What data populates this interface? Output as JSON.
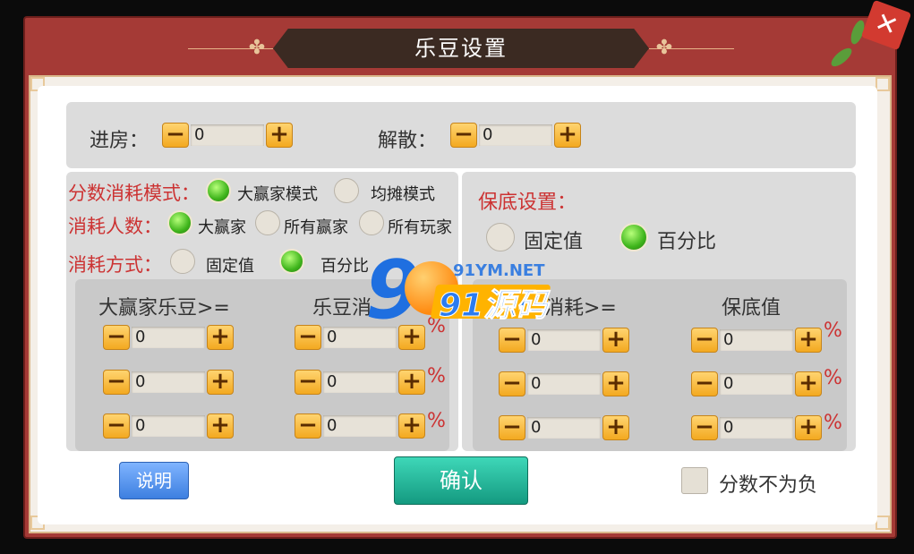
{
  "title": "乐豆设置",
  "close_label": "✕",
  "top_row": {
    "enter_label": "进房：",
    "enter_value": "0",
    "dissolve_label": "解散：",
    "dissolve_value": "0"
  },
  "minus": "−",
  "plus": "+",
  "score_mode": {
    "label": "分数消耗模式：",
    "options": [
      "大赢家模式",
      "均摊模式"
    ],
    "selected": "大赢家模式"
  },
  "consume_people": {
    "label": "消耗人数：",
    "options": [
      "大赢家",
      "所有赢家",
      "所有玩家"
    ],
    "selected": "大赢家"
  },
  "consume_method": {
    "label": "消耗方式：",
    "options": [
      "固定值",
      "百分比"
    ],
    "selected": "百分比"
  },
  "guarantee": {
    "label": "保底设置：",
    "options": [
      "固定值",
      "百分比"
    ],
    "selected": "百分比"
  },
  "left_table": {
    "headers": [
      "大赢家乐豆>=",
      "乐豆消"
    ],
    "rows": [
      [
        "0",
        "0"
      ],
      [
        "0",
        "0"
      ],
      [
        "0",
        "0"
      ]
    ]
  },
  "right_table": {
    "headers": [
      "消耗>=",
      "保底值"
    ],
    "rows": [
      [
        "0",
        "0"
      ],
      [
        "0",
        "0"
      ],
      [
        "0",
        "0"
      ]
    ]
  },
  "percent": "%",
  "buttons": {
    "help": "说明",
    "confirm": "确认"
  },
  "no_negative_label": "分数不为负",
  "watermark": {
    "site": "91YM.NET",
    "brand": "91源码"
  },
  "colors": {
    "frame": "#a53a36",
    "accent_green": "#3fb51c",
    "confirm": "#1aa98c",
    "stepper": "#f3a920"
  }
}
